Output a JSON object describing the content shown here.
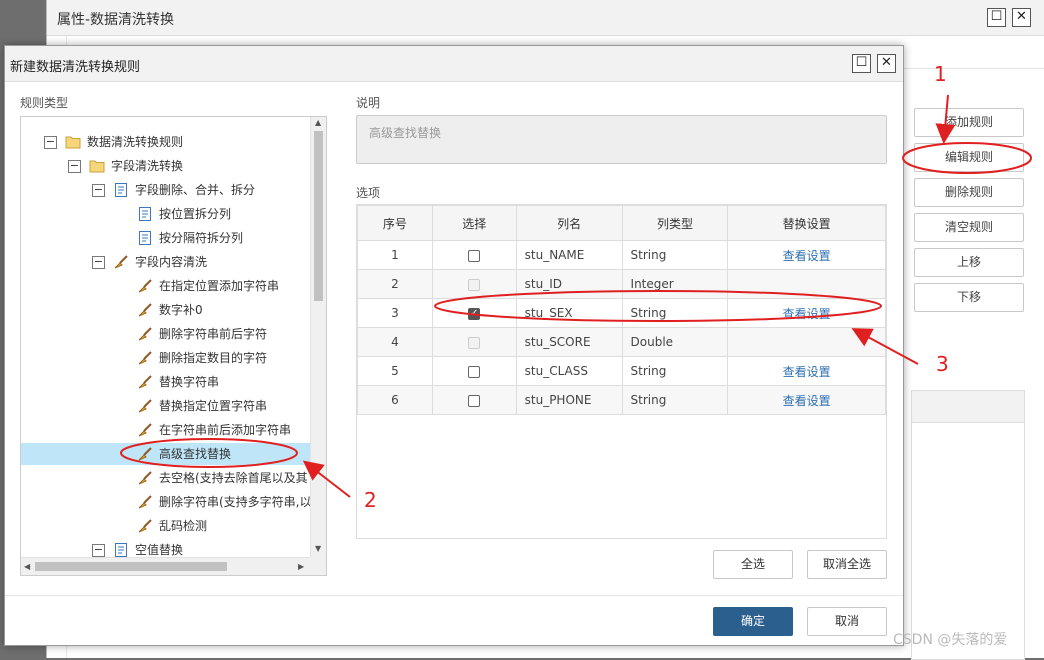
{
  "bg_window": {
    "title": "属性-数据清洗转换",
    "buttons": [
      "添加规则",
      "编辑规则",
      "删除规则",
      "清空规则",
      "上移",
      "下移"
    ]
  },
  "dialog": {
    "title": "新建数据清洗转换规则",
    "rule_type_label": "规则类型",
    "desc_label": "说明",
    "desc_value": "高级查找替换",
    "options_label": "选项",
    "tree": [
      {
        "label": "数据清洗转换规则",
        "icon": "folder-icon",
        "expander": "−"
      },
      {
        "label": "字段清洗转换",
        "icon": "folder-icon",
        "expander": "−"
      },
      {
        "label": "字段删除、合并、拆分",
        "icon": "doc-icon",
        "expander": "−"
      },
      {
        "label": "按位置拆分列",
        "icon": "doc-icon",
        "expander": ""
      },
      {
        "label": "按分隔符拆分列",
        "icon": "doc-icon",
        "expander": ""
      },
      {
        "label": "字段内容清洗",
        "icon": "broom-icon",
        "expander": "−"
      },
      {
        "label": "在指定位置添加字符串",
        "icon": "broom-icon",
        "expander": ""
      },
      {
        "label": "数字补0",
        "icon": "broom-icon",
        "expander": ""
      },
      {
        "label": "删除字符串前后字符",
        "icon": "broom-icon",
        "expander": ""
      },
      {
        "label": "删除指定数目的字符",
        "icon": "broom-icon",
        "expander": ""
      },
      {
        "label": "替换字符串",
        "icon": "broom-icon",
        "expander": ""
      },
      {
        "label": "替换指定位置字符串",
        "icon": "broom-icon",
        "expander": ""
      },
      {
        "label": "在字符串前后添加字符串",
        "icon": "broom-icon",
        "expander": ""
      },
      {
        "label": "高级查找替换",
        "icon": "broom-icon",
        "expander": "",
        "selected": true
      },
      {
        "label": "去空格(支持去除首尾以及其",
        "icon": "broom-icon",
        "expander": ""
      },
      {
        "label": "删除字符串(支持多字符串,以",
        "icon": "broom-icon",
        "expander": ""
      },
      {
        "label": "乱码检测",
        "icon": "broom-icon",
        "expander": ""
      },
      {
        "label": "空值替换",
        "icon": "doc-icon",
        "expander": "−"
      }
    ],
    "table": {
      "headers": [
        "序号",
        "选择",
        "列名",
        "列类型",
        "替换设置"
      ],
      "rows": [
        {
          "no": "1",
          "check": "empty",
          "name": "stu_NAME",
          "type": "String",
          "setting": "查看设置"
        },
        {
          "no": "2",
          "check": "disabled",
          "name": "stu_ID",
          "type": "Integer",
          "setting": ""
        },
        {
          "no": "3",
          "check": "checked",
          "name": "stu_SEX",
          "type": "String",
          "setting": "查看设置"
        },
        {
          "no": "4",
          "check": "disabled",
          "name": "stu_SCORE",
          "type": "Double",
          "setting": ""
        },
        {
          "no": "5",
          "check": "empty",
          "name": "stu_CLASS",
          "type": "String",
          "setting": "查看设置"
        },
        {
          "no": "6",
          "check": "empty",
          "name": "stu_PHONE",
          "type": "String",
          "setting": "查看设置"
        }
      ]
    },
    "select_all": "全选",
    "deselect_all": "取消全选",
    "ok": "确定",
    "cancel": "取消"
  },
  "annotations": [
    "1",
    "2",
    "3"
  ],
  "watermark": "CSDN @失落的爱",
  "colors": {
    "annotation": "#e02020",
    "primary": "#2b5f8e",
    "link": "#2f6fb3",
    "selection": "#bfe6f8"
  }
}
